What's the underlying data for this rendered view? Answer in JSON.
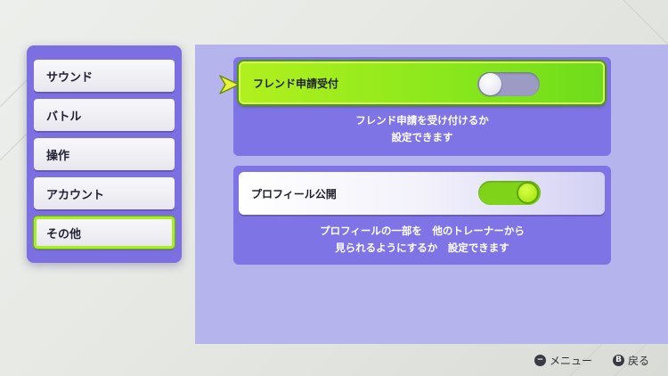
{
  "sidebar": {
    "items": [
      {
        "label": "サウンド"
      },
      {
        "label": "バトル"
      },
      {
        "label": "操作"
      },
      {
        "label": "アカウント"
      },
      {
        "label": "その他",
        "selected": true
      }
    ]
  },
  "settings": [
    {
      "label": "フレンド申請受付",
      "enabled": false,
      "description_line1": "フレンド申請を受け付けるか",
      "description_line2": "設定できます"
    },
    {
      "label": "プロフィール公開",
      "enabled": true,
      "description_line1": "プロフィールの一部を　他のトレーナーから",
      "description_line2": "見られるようにするか　設定できます"
    }
  ],
  "footer": {
    "menu_button_glyph": "−",
    "menu_label": "メニュー",
    "back_button_glyph": "B",
    "back_label": "戻る"
  },
  "colors": {
    "accent_purple": "#7c6fe1",
    "highlight_green": "#a7ed2b",
    "toggle_on": "#7fd41a",
    "toggle_off": "#9b9bc4"
  }
}
